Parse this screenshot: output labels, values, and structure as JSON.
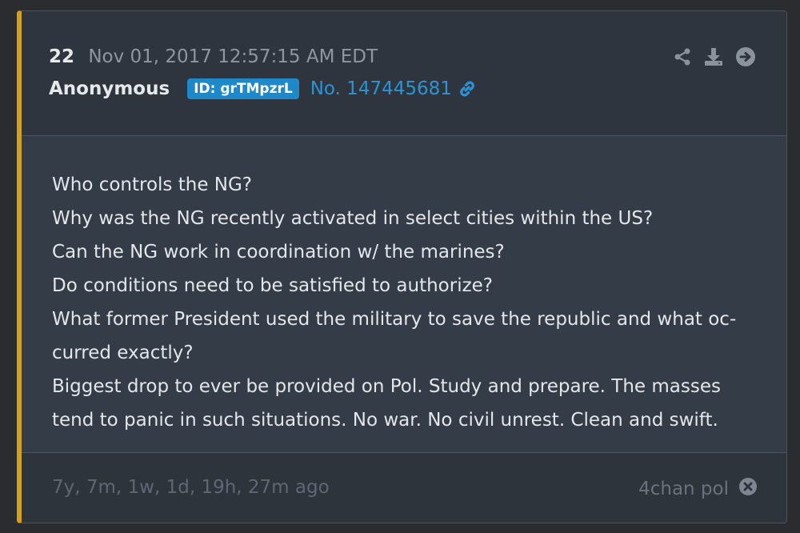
{
  "post": {
    "number": "22",
    "timestamp": "Nov 01, 2017 12:57:15 AM EDT",
    "author": "Anonymous",
    "id_badge": "ID: grTMpzrL",
    "post_no": "No. 147445681",
    "body_lines": [
      "Who controls the NG?",
      "Why was the NG recently activated in select cities within the US?",
      "Can the NG work in coordination w/ the marines?",
      "Do conditions need to be satisfied to authorize?",
      "What former President used the military to save the republic and what oc-",
      "curred exactly?",
      "Biggest drop to ever be provided on Pol. Study and prepare. The masses",
      "tend to panic in such situations. No war. No civil unrest. Clean and swift."
    ],
    "time_ago": "7y, 7m, 1w, 1d, 19h, 27m ago",
    "source": "4chan pol"
  },
  "icons": {
    "share": "share-icon",
    "download": "download-icon",
    "go": "arrow-circle-right-icon",
    "link": "link-icon",
    "close": "close-circle-icon"
  },
  "colors": {
    "accent_border": "#d3a21c",
    "id_badge_bg": "#1e88c8",
    "link_blue": "#2d93d4",
    "background": "#2a2c30"
  }
}
